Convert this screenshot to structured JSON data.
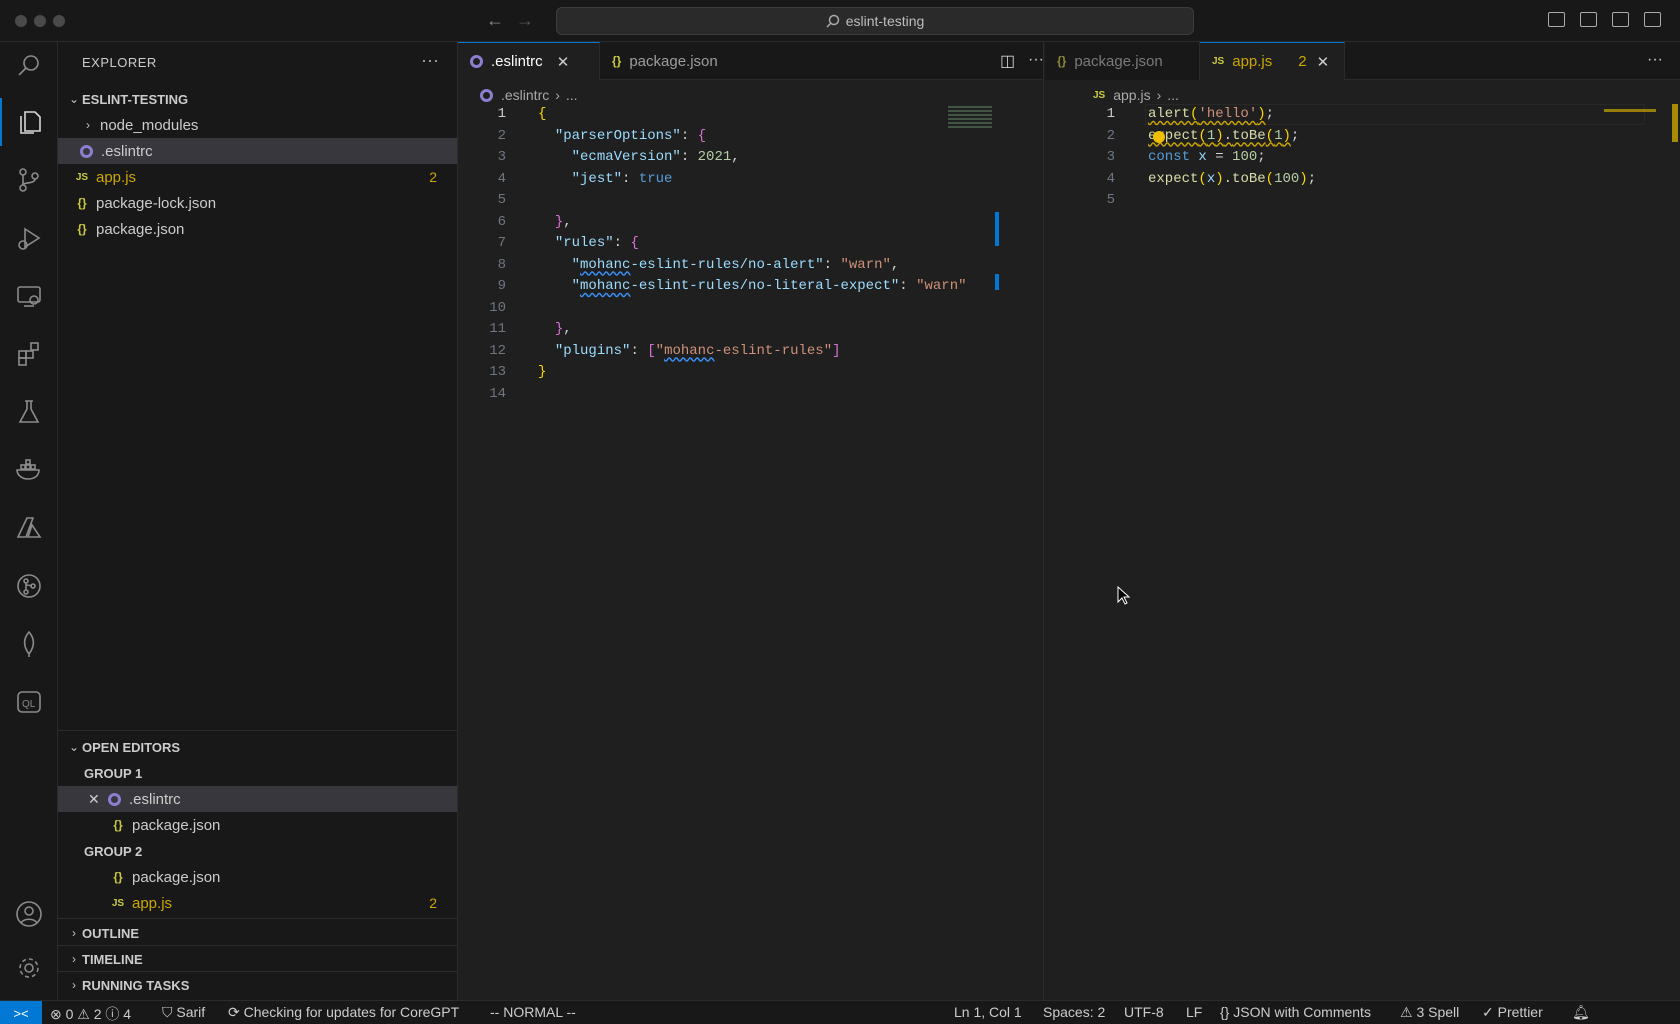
{
  "window": {
    "search_text": "eslint-testing"
  },
  "activity_bar": [
    "search-icon",
    "files-icon",
    "source-control-icon",
    "run-debug-icon",
    "remote-explorer-icon",
    "extensions-icon",
    "testing-icon",
    "docker-icon",
    "azure-icon",
    "git-graph-icon",
    "mongodb-icon",
    "codeql-icon",
    "account-icon",
    "settings-gear-icon"
  ],
  "explorer": {
    "title": "EXPLORER",
    "more": "···",
    "project": "ESLINT-TESTING",
    "files": [
      {
        "name": "node_modules",
        "type": "folder"
      },
      {
        "name": ".eslintrc",
        "type": "eslintrc"
      },
      {
        "name": "app.js",
        "type": "js",
        "badge": "2"
      },
      {
        "name": "package-lock.json",
        "type": "json"
      },
      {
        "name": "package.json",
        "type": "json"
      }
    ]
  },
  "open_editors": {
    "title": "OPEN EDITORS",
    "group1": "GROUP 1",
    "group1_items": [
      ".eslintrc",
      "package.json"
    ],
    "group2": "GROUP 2",
    "group2_items": [
      "package.json",
      "app.js"
    ],
    "app_badge": "2"
  },
  "sections": {
    "outline": "OUTLINE",
    "timeline": "TIMELINE",
    "running_tasks": "RUNNING TASKS"
  },
  "editor1": {
    "tabs": [
      ".eslintrc",
      "package.json"
    ],
    "breadcrumb": ".eslintrc",
    "breadcrumb_more": "...",
    "line_numbers": [
      "1",
      "2",
      "3",
      "4",
      "5",
      "6",
      "7",
      "8",
      "9",
      "10",
      "11",
      "12",
      "13",
      "14"
    ]
  },
  "editor2": {
    "tabs": [
      "package.json",
      "app.js"
    ],
    "app_badge": "2",
    "breadcrumb": "app.js",
    "breadcrumb_more": "...",
    "line_numbers": [
      "1",
      "2",
      "3",
      "4",
      "5"
    ]
  },
  "status_bar": {
    "problems": "⊗ 0 ⚠ 2 ⓘ 4",
    "sarif": "Sarif",
    "updates": "Checking for updates for CoreGPT",
    "mode": "-- NORMAL --",
    "position": "Ln 1, Col 1",
    "spaces": "Spaces: 2",
    "encoding": "UTF-8",
    "eol": "LF",
    "language": "JSON with Comments",
    "spell": "3 Spell",
    "prettier": "Prettier"
  }
}
